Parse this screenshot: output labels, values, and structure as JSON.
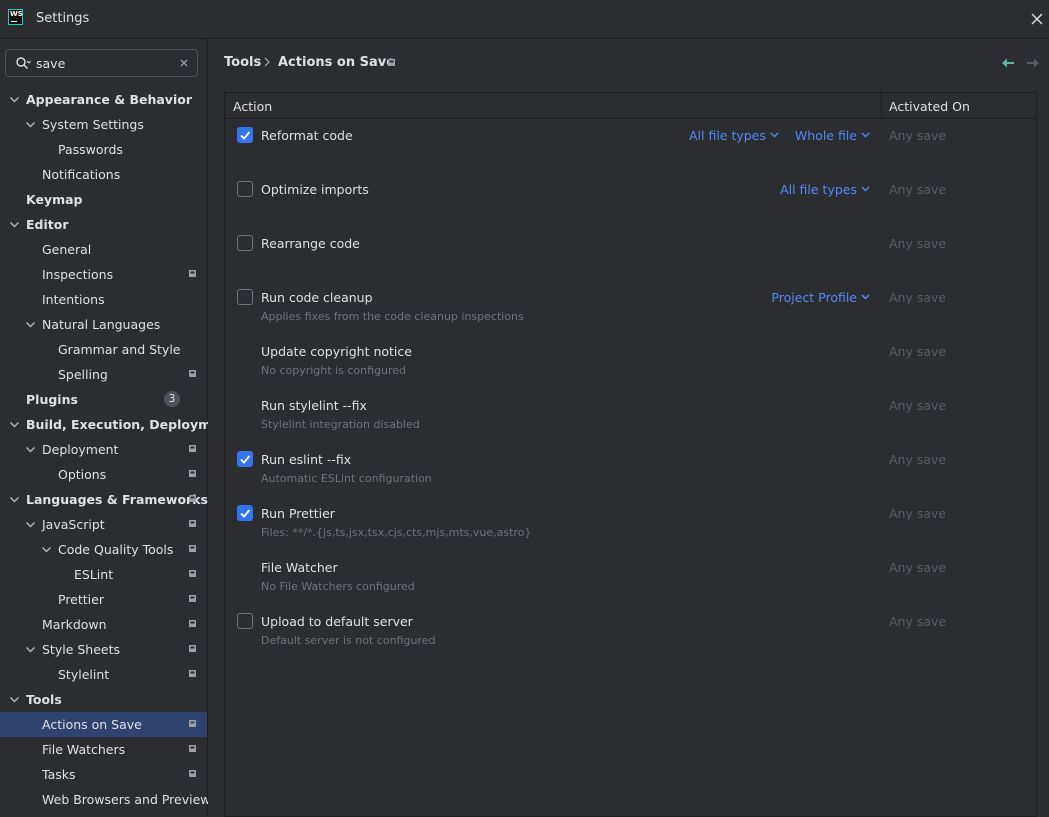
{
  "window": {
    "title": "Settings",
    "logo_text": "WS"
  },
  "search": {
    "value": "save",
    "placeholder": ""
  },
  "sidebar": {
    "items": [
      {
        "label": "Appearance & Behavior",
        "level": 0,
        "bold": true,
        "expanded": true
      },
      {
        "label": "System Settings",
        "level": 1,
        "expanded": true
      },
      {
        "label": "Passwords",
        "level": 2
      },
      {
        "label": "Notifications",
        "level": 1
      },
      {
        "label": "Keymap",
        "level": 0,
        "bold": true
      },
      {
        "label": "Editor",
        "level": 0,
        "bold": true,
        "expanded": true
      },
      {
        "label": "General",
        "level": 1
      },
      {
        "label": "Inspections",
        "level": 1,
        "project": true
      },
      {
        "label": "Intentions",
        "level": 1
      },
      {
        "label": "Natural Languages",
        "level": 1,
        "expanded": true
      },
      {
        "label": "Grammar and Style",
        "level": 2
      },
      {
        "label": "Spelling",
        "level": 2,
        "project": true
      },
      {
        "label": "Plugins",
        "level": 0,
        "bold": true,
        "count": "3"
      },
      {
        "label": "Build, Execution, Deployment",
        "level": 0,
        "bold": true,
        "expanded": true
      },
      {
        "label": "Deployment",
        "level": 1,
        "expanded": true,
        "project": true
      },
      {
        "label": "Options",
        "level": 2,
        "project": true
      },
      {
        "label": "Languages & Frameworks",
        "level": 0,
        "bold": true,
        "expanded": true,
        "project": true
      },
      {
        "label": "JavaScript",
        "level": 1,
        "expanded": true,
        "project": true
      },
      {
        "label": "Code Quality Tools",
        "level": 2,
        "expanded": true,
        "project": true
      },
      {
        "label": "ESLint",
        "level": 3,
        "project": true
      },
      {
        "label": "Prettier",
        "level": 2,
        "project": true
      },
      {
        "label": "Markdown",
        "level": 1,
        "project": true
      },
      {
        "label": "Style Sheets",
        "level": 1,
        "expanded": true,
        "project": true
      },
      {
        "label": "Stylelint",
        "level": 2,
        "project": true
      },
      {
        "label": "Tools",
        "level": 0,
        "bold": true,
        "expanded": true
      },
      {
        "label": "Actions on Save",
        "level": 1,
        "project": true,
        "selected": true
      },
      {
        "label": "File Watchers",
        "level": 1,
        "project": true
      },
      {
        "label": "Tasks",
        "level": 1,
        "project": true
      },
      {
        "label": "Web Browsers and Preview",
        "level": 1
      }
    ]
  },
  "breadcrumb": {
    "parent": "Tools",
    "current": "Actions on Save"
  },
  "table": {
    "col_action": "Action",
    "col_activated": "Activated On",
    "rows": [
      {
        "title": "Reformat code",
        "checked": true,
        "dropdowns": [
          "All file types",
          "Whole file"
        ],
        "activated": "Any save"
      },
      {
        "title": "Optimize imports",
        "checked": false,
        "dropdowns": [
          "All file types"
        ],
        "activated": "Any save"
      },
      {
        "title": "Rearrange code",
        "checked": false,
        "activated": "Any save"
      },
      {
        "title": "Run code cleanup",
        "checked": false,
        "subtitle": "Applies fixes from the code cleanup inspections",
        "dropdowns": [
          "Project Profile"
        ],
        "activated": "Any save"
      },
      {
        "title": "Update copyright notice",
        "subtitle": "No copyright is configured",
        "activated": "Any save"
      },
      {
        "title": "Run stylelint --fix",
        "subtitle": "Stylelint integration disabled",
        "activated": "Any save"
      },
      {
        "title": "Run eslint --fix",
        "checked": true,
        "subtitle": "Automatic ESLint configuration",
        "activated": "Any save"
      },
      {
        "title": "Run Prettier",
        "checked": true,
        "subtitle": "Files: **/*.{js,ts,jsx,tsx,cjs,cts,mjs,mts,vue,astro}",
        "activated": "Any save"
      },
      {
        "title": "File Watcher",
        "subtitle": "No File Watchers configured",
        "activated": "Any save"
      },
      {
        "title": "Upload to default server",
        "checked": false,
        "subtitle": "Default server is not configured",
        "activated": "Any save"
      }
    ]
  },
  "colors": {
    "background": "#2b2d30",
    "selection": "#2e436e",
    "accent": "#3574f0",
    "link": "#548af7",
    "muted": "#6f737a",
    "nav_back": "#5fb8a4"
  }
}
